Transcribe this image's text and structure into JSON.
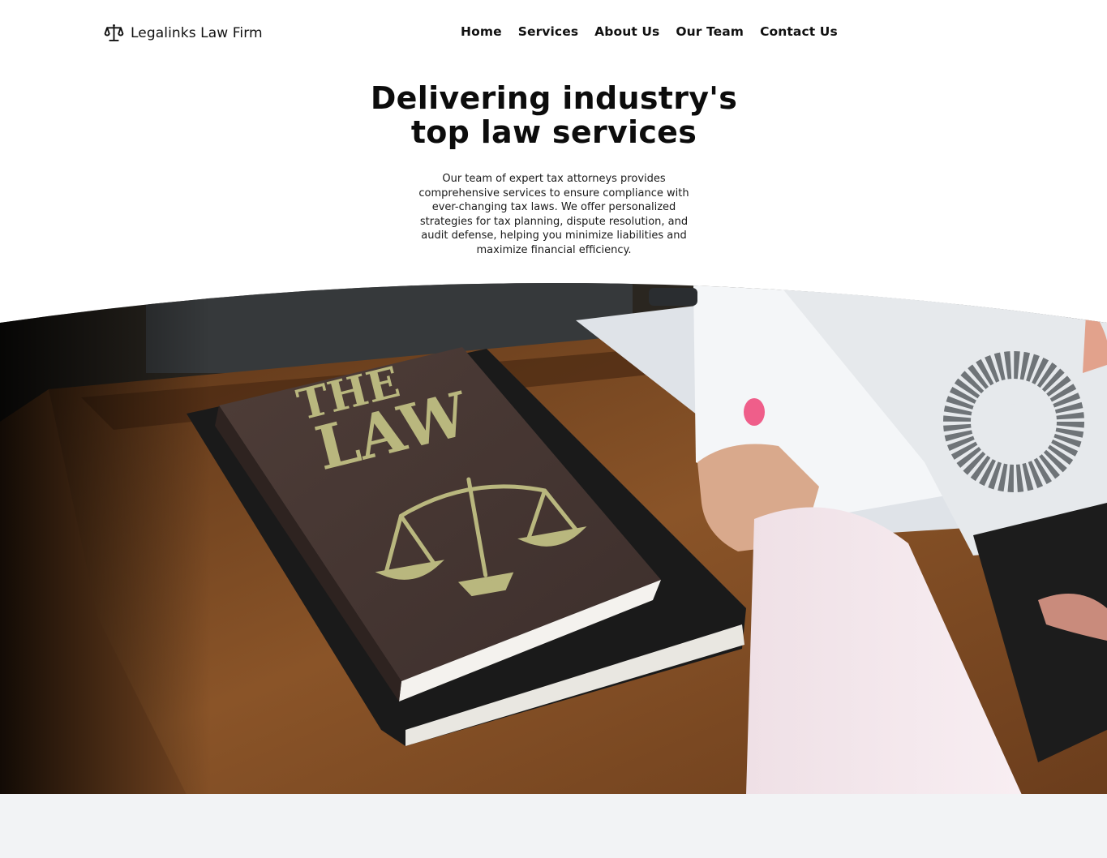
{
  "header": {
    "brand": {
      "name": "Legalinks Law Firm",
      "icon": "scales-icon"
    },
    "nav": [
      {
        "label": "Home"
      },
      {
        "label": "Services"
      },
      {
        "label": "About Us"
      },
      {
        "label": "Our Team"
      },
      {
        "label": "Contact Us"
      }
    ]
  },
  "hero": {
    "title_line1": "Delivering industry's",
    "title_line2": "top law services",
    "description": "Our team of expert tax attorneys provides comprehensive services to ensure compliance with ever-changing tax laws. We offer personalized strategies for tax planning, dispute resolution, and audit defense, helping you minimize liabilities and maximize financial efficiency."
  },
  "photo": {
    "book_cover_line1": "THE",
    "book_cover_line2": "LAW"
  },
  "colors": {
    "text": "#111111",
    "background": "#ffffff",
    "footer_band": "#f2f3f5",
    "book_gold": "#b9b77e",
    "book_leather": "#4a3a35"
  }
}
